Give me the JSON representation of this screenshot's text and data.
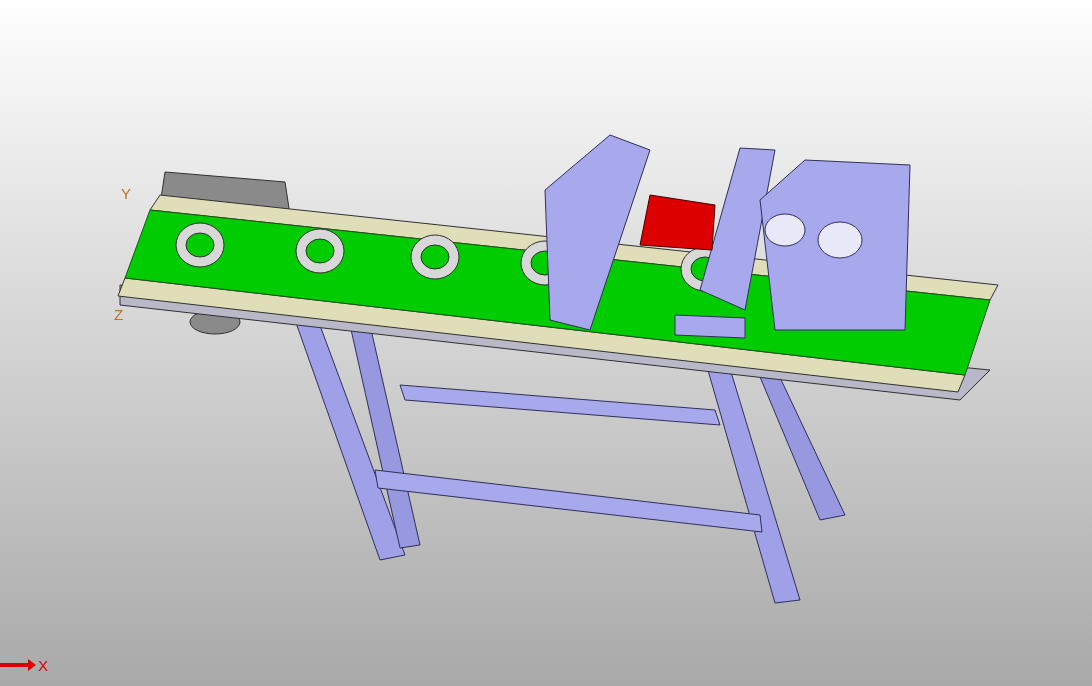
{
  "model_triad": {
    "labels": [
      {
        "kind": "y",
        "text": "Y"
      },
      {
        "kind": "z",
        "text": "Z"
      }
    ]
  },
  "corner_axis": {
    "label": "X"
  }
}
